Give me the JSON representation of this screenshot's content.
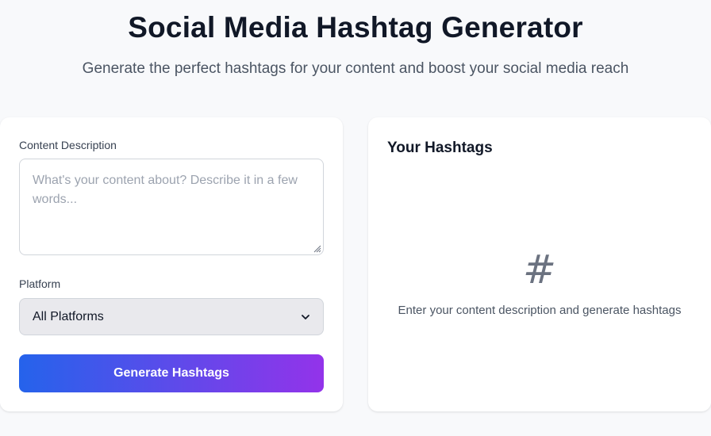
{
  "header": {
    "title": "Social Media Hashtag Generator",
    "subtitle": "Generate the perfect hashtags for your content and boost your social media reach"
  },
  "form": {
    "content_label": "Content Description",
    "content_placeholder": "What's your content about? Describe it in a few words...",
    "content_value": "",
    "platform_label": "Platform",
    "platform_selected": "All Platforms",
    "generate_label": "Generate Hashtags"
  },
  "results": {
    "title": "Your Hashtags",
    "empty_icon": "hash-icon",
    "empty_glyph": "#",
    "empty_message": "Enter your content description and generate hashtags"
  },
  "colors": {
    "gradient_start": "#2563eb",
    "gradient_end": "#9333ea",
    "background": "#f8f9fb"
  }
}
